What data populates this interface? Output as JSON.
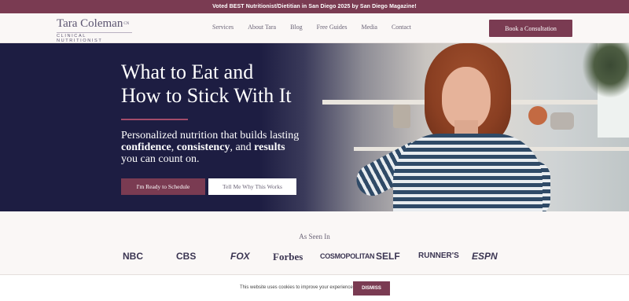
{
  "announcement": "Voted BEST Nutritionist/Dietitian in San Diego 2025 by San Diego Magazine!",
  "logo": {
    "name": "Tara Coleman",
    "suffix": "CN",
    "subtitle": "CLINICAL NUTRITIONIST"
  },
  "nav": {
    "items": [
      "Services",
      "About Tara",
      "Blog",
      "Free Guides",
      "Media",
      "Contact"
    ],
    "cta_label": "Book a Consultation"
  },
  "hero": {
    "title_line1": "What to Eat and",
    "title_line2": "How to Stick With It",
    "sub_intro": "Personalized nutrition that builds lasting ",
    "sub_bold1": "confidence",
    "sub_sep1": ", ",
    "sub_bold2": "consistency",
    "sub_sep2": ", and ",
    "sub_bold3": "results",
    "sub_outro": " you can count on.",
    "primary_button": "I'm Ready to Schedule",
    "secondary_button": "Tell Me Why This Works"
  },
  "press": {
    "title": "As Seen In",
    "logos": [
      "NBC",
      "CBS",
      "FOX",
      "Forbes",
      "COSMOPOLITAN",
      "SELF",
      "RUNNER'S",
      "ESPN"
    ]
  },
  "cookie": {
    "text": "This website uses cookies to improve your experience.",
    "dismiss_label": "DISMISS"
  },
  "colors": {
    "brand": "#7a3b52",
    "hero_bg": "#1d1d42",
    "accent_rule": "#a34c6a"
  }
}
